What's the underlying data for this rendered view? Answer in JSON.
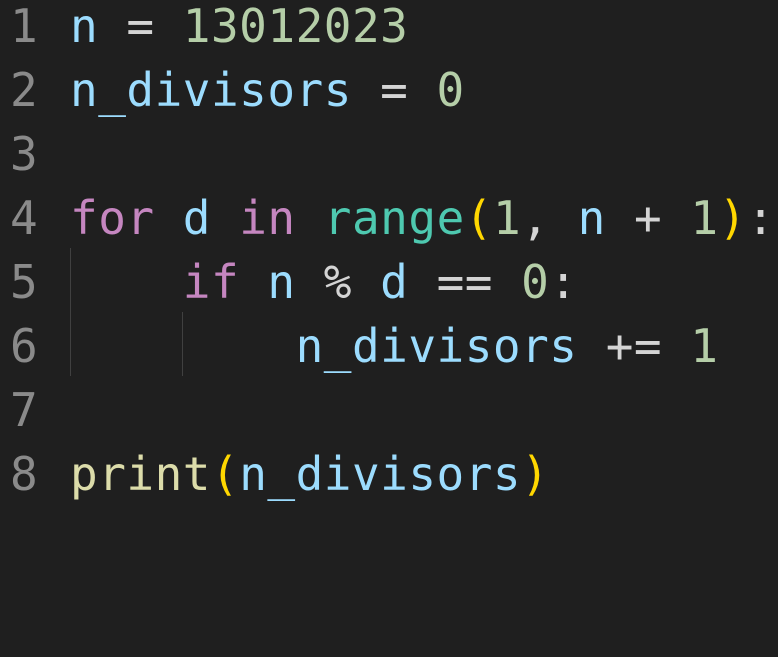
{
  "editor": {
    "lines": [
      {
        "number": "1",
        "tokens": [
          "n",
          " = ",
          "13012023"
        ]
      },
      {
        "number": "2",
        "tokens": [
          "n_divisors",
          " = ",
          "0"
        ]
      },
      {
        "number": "3",
        "tokens": []
      },
      {
        "number": "4",
        "tokens": [
          "for",
          " ",
          "d",
          " ",
          "in",
          " ",
          "range",
          "(",
          "1",
          ", ",
          "n",
          " + ",
          "1",
          ")",
          ":"
        ]
      },
      {
        "number": "5",
        "tokens": [
          "    ",
          "if",
          " ",
          "n",
          " % ",
          "d",
          " == ",
          "0",
          ":"
        ]
      },
      {
        "number": "6",
        "tokens": [
          "        ",
          "n_divisors",
          " += ",
          "1"
        ]
      },
      {
        "number": "7",
        "tokens": []
      },
      {
        "number": "8",
        "tokens": [
          "print",
          "(",
          "n_divisors",
          ")"
        ]
      }
    ]
  },
  "colors": {
    "background": "#1f1f1f",
    "line_number": "#8a8a8a",
    "variable": "#9cdcfe",
    "number": "#b5cea8",
    "keyword": "#c586c0",
    "builtin": "#4ec9b0",
    "function": "#dcdcaa",
    "bracket": "#ffd700",
    "operator": "#d4d4d4"
  }
}
